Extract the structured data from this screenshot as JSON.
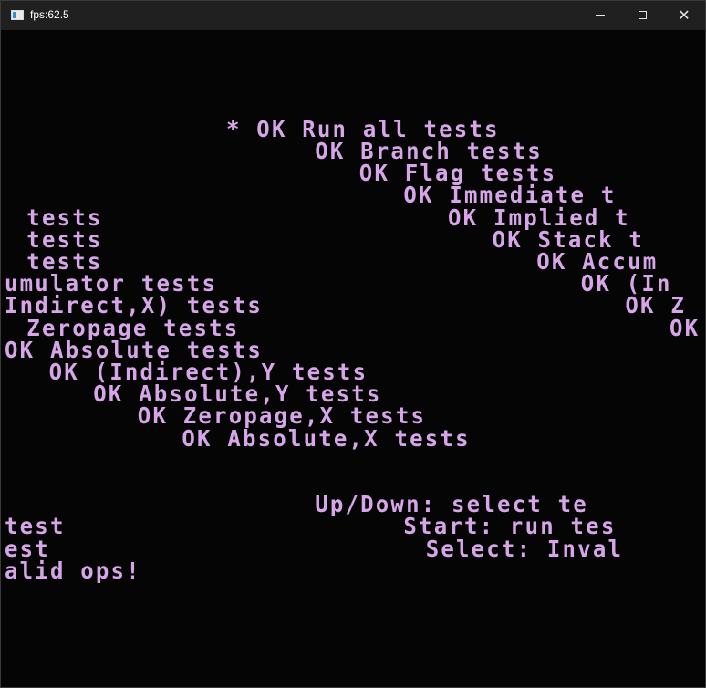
{
  "window": {
    "title": "fps:62.5",
    "app_icon": "window-app-icon",
    "buttons": {
      "minimize": "minimize-icon",
      "maximize": "maximize-icon",
      "close": "close-icon"
    }
  },
  "screen": {
    "text_color": "#d6a6e8",
    "background": "#050505",
    "lines": [
      {
        "row": 4,
        "col": 10,
        "text": "* OK Run all tests"
      },
      {
        "row": 5,
        "col": 14,
        "text": "OK Branch tests"
      },
      {
        "row": 6,
        "col": 16,
        "text": "OK Flag tests"
      },
      {
        "row": 7,
        "col": 18,
        "text": "OK Immediate t"
      },
      {
        "row": 8,
        "col": 1,
        "text": "tests"
      },
      {
        "row": 8,
        "col": 20,
        "text": "OK Implied t"
      },
      {
        "row": 9,
        "col": 1,
        "text": "tests"
      },
      {
        "row": 9,
        "col": 22,
        "text": "OK Stack t"
      },
      {
        "row": 10,
        "col": 1,
        "text": "tests"
      },
      {
        "row": 10,
        "col": 24,
        "text": "OK Accum"
      },
      {
        "row": 11,
        "col": 0,
        "text": "umulator tests"
      },
      {
        "row": 11,
        "col": 26,
        "text": "OK (In"
      },
      {
        "row": 12,
        "col": 0,
        "text": "Indirect,X) tests"
      },
      {
        "row": 12,
        "col": 28,
        "text": "OK Z"
      },
      {
        "row": 13,
        "col": 1,
        "text": "Zeropage tests"
      },
      {
        "row": 13,
        "col": 30,
        "text": "OK"
      },
      {
        "row": 14,
        "col": 0,
        "text": "OK Absolute tests"
      },
      {
        "row": 15,
        "col": 2,
        "text": "OK (Indirect),Y tests"
      },
      {
        "row": 16,
        "col": 4,
        "text": "OK Absolute,Y tests"
      },
      {
        "row": 17,
        "col": 6,
        "text": "OK Zeropage,X tests"
      },
      {
        "row": 18,
        "col": 8,
        "text": "OK Absolute,X tests"
      },
      {
        "row": 21,
        "col": 14,
        "text": "Up/Down: select te"
      },
      {
        "row": 22,
        "col": 0,
        "text": "test"
      },
      {
        "row": 22,
        "col": 18,
        "text": "Start: run tes"
      },
      {
        "row": 23,
        "col": 0,
        "text": "est"
      },
      {
        "row": 23,
        "col": 19,
        "text": "Select: Inval"
      },
      {
        "row": 24,
        "col": 0,
        "text": "alid ops!"
      }
    ]
  }
}
